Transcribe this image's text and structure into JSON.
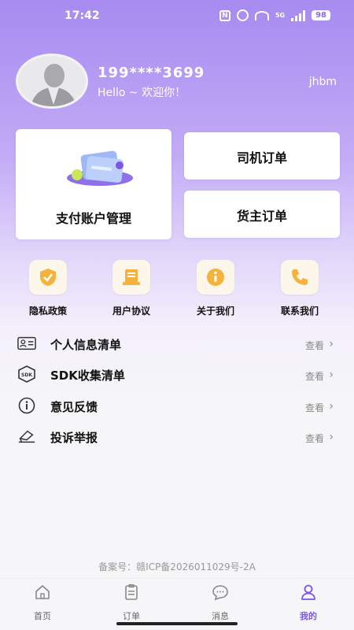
{
  "status_bar": {
    "time": "17:42",
    "battery": "98",
    "nfc": "N",
    "network": "5G"
  },
  "profile": {
    "phone": "199****3699",
    "greeting": "Hello ~ 欢迎你！",
    "username": "jhbm"
  },
  "cards": {
    "pay": "支付账户管理",
    "driver_orders": "司机订单",
    "owner_orders": "货主订单"
  },
  "quick_links": [
    {
      "label": "隐私政策",
      "icon": "shield-check-icon"
    },
    {
      "label": "用户协议",
      "icon": "document-icon"
    },
    {
      "label": "关于我们",
      "icon": "info-icon"
    },
    {
      "label": "联系我们",
      "icon": "phone-icon"
    }
  ],
  "list": [
    {
      "label": "个人信息清单",
      "action": "查看",
      "icon": "id-card-icon"
    },
    {
      "label": "SDK收集清单",
      "action": "查看",
      "icon": "sdk-icon"
    },
    {
      "label": "意见反馈",
      "action": "查看",
      "icon": "info-circle-icon"
    },
    {
      "label": "投诉举报",
      "action": "查看",
      "icon": "report-icon"
    }
  ],
  "icp": "备案号：赣ICP备2026011029号-2A",
  "tabs": [
    {
      "label": "首页",
      "icon": "home-icon"
    },
    {
      "label": "订单",
      "icon": "clipboard-icon"
    },
    {
      "label": "消息",
      "icon": "chat-icon"
    },
    {
      "label": "我的",
      "icon": "user-icon",
      "active": true
    }
  ],
  "colors": {
    "accent": "#7c57e6",
    "header_gradient_top": "#a78bf0",
    "quick_icon_orange": "#f5b23c"
  }
}
